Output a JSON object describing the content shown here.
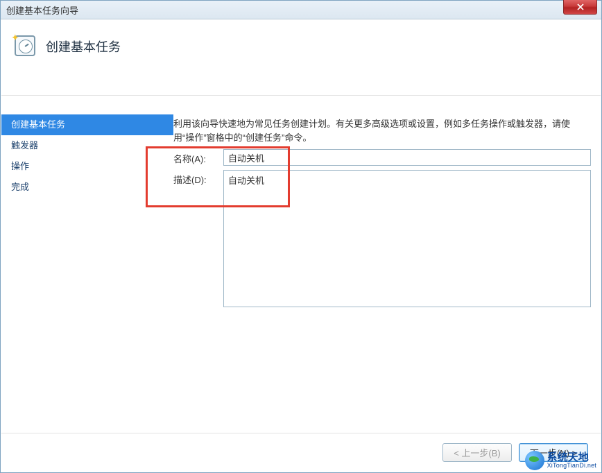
{
  "window": {
    "title": "创建基本任务向导"
  },
  "header": {
    "title": "创建基本任务"
  },
  "sidebar": {
    "items": [
      {
        "label": "创建基本任务",
        "selected": true
      },
      {
        "label": "触发器",
        "selected": false
      },
      {
        "label": "操作",
        "selected": false
      },
      {
        "label": "完成",
        "selected": false
      }
    ]
  },
  "main": {
    "hint": "利用该向导快速地为常见任务创建计划。有关更多高级选项或设置，例如多任务操作或触发器，请使用“操作”窗格中的“创建任务”命令。",
    "name_label": "名称(A):",
    "name_value": "自动关机",
    "desc_label": "描述(D):",
    "desc_value": "自动关机"
  },
  "footer": {
    "back": "< 上一步(B)",
    "next": "下一步(N) >",
    "cancel_partial": ""
  },
  "watermark": {
    "main": "系统天地",
    "sub": "XiTongTianDi.net"
  }
}
